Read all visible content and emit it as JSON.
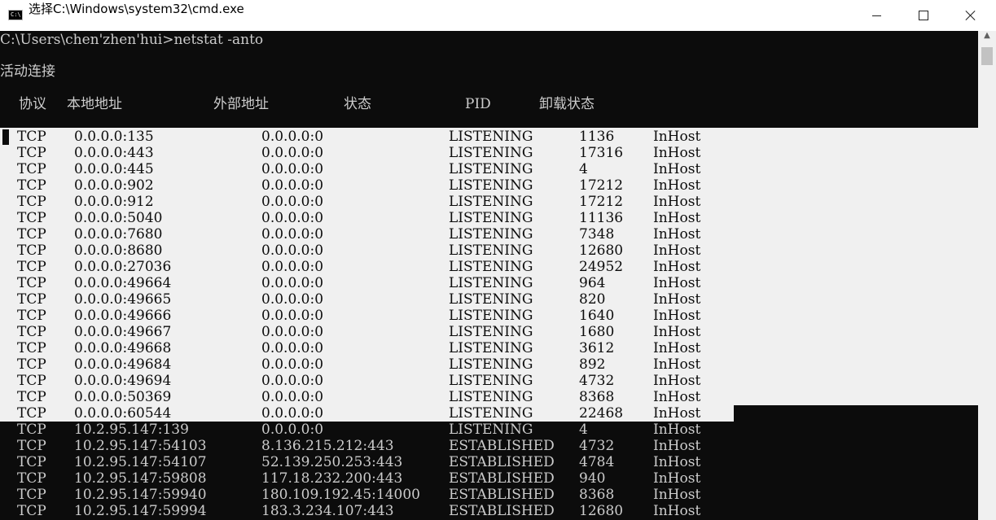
{
  "window": {
    "title": "选择C:\\Windows\\system32\\cmd.exe",
    "icon_text": "C:\\",
    "controls": {
      "minimize": "minimize-icon",
      "maximize": "maximize-icon",
      "close": "close-icon"
    }
  },
  "console": {
    "command_line": "C:\\Users\\chen'zhen'hui>netstat -anto",
    "section_title": "活动连接",
    "headers": {
      "proto": "协议",
      "local": "本地地址",
      "foreign": "外部地址",
      "state": "状态",
      "pid": "PID",
      "offload": "卸载状态"
    },
    "rows": [
      [
        "TCP",
        "0.0.0.0:135",
        "0.0.0.0:0",
        "LISTENING",
        "1136",
        "InHost"
      ],
      [
        "TCP",
        "0.0.0.0:443",
        "0.0.0.0:0",
        "LISTENING",
        "17316",
        "InHost"
      ],
      [
        "TCP",
        "0.0.0.0:445",
        "0.0.0.0:0",
        "LISTENING",
        "4",
        "InHost"
      ],
      [
        "TCP",
        "0.0.0.0:902",
        "0.0.0.0:0",
        "LISTENING",
        "17212",
        "InHost"
      ],
      [
        "TCP",
        "0.0.0.0:912",
        "0.0.0.0:0",
        "LISTENING",
        "17212",
        "InHost"
      ],
      [
        "TCP",
        "0.0.0.0:5040",
        "0.0.0.0:0",
        "LISTENING",
        "11136",
        "InHost"
      ],
      [
        "TCP",
        "0.0.0.0:7680",
        "0.0.0.0:0",
        "LISTENING",
        "7348",
        "InHost"
      ],
      [
        "TCP",
        "0.0.0.0:8680",
        "0.0.0.0:0",
        "LISTENING",
        "12680",
        "InHost"
      ],
      [
        "TCP",
        "0.0.0.0:27036",
        "0.0.0.0:0",
        "LISTENING",
        "24952",
        "InHost"
      ],
      [
        "TCP",
        "0.0.0.0:49664",
        "0.0.0.0:0",
        "LISTENING",
        "964",
        "InHost"
      ],
      [
        "TCP",
        "0.0.0.0:49665",
        "0.0.0.0:0",
        "LISTENING",
        "820",
        "InHost"
      ],
      [
        "TCP",
        "0.0.0.0:49666",
        "0.0.0.0:0",
        "LISTENING",
        "1640",
        "InHost"
      ],
      [
        "TCP",
        "0.0.0.0:49667",
        "0.0.0.0:0",
        "LISTENING",
        "1680",
        "InHost"
      ],
      [
        "TCP",
        "0.0.0.0:49668",
        "0.0.0.0:0",
        "LISTENING",
        "3612",
        "InHost"
      ],
      [
        "TCP",
        "0.0.0.0:49684",
        "0.0.0.0:0",
        "LISTENING",
        "892",
        "InHost"
      ],
      [
        "TCP",
        "0.0.0.0:49694",
        "0.0.0.0:0",
        "LISTENING",
        "4732",
        "InHost"
      ],
      [
        "TCP",
        "0.0.0.0:50369",
        "0.0.0.0:0",
        "LISTENING",
        "8368",
        "InHost"
      ],
      [
        "TCP",
        "0.0.0.0:60544",
        "0.0.0.0:0",
        "LISTENING",
        "22468",
        "InHost"
      ],
      [
        "TCP",
        "10.2.95.147:139",
        "0.0.0.0:0",
        "LISTENING",
        "4",
        "InHost"
      ],
      [
        "TCP",
        "10.2.95.147:54103",
        "8.136.215.212:443",
        "ESTABLISHED",
        "4732",
        "InHost"
      ],
      [
        "TCP",
        "10.2.95.147:54107",
        "52.139.250.253:443",
        "ESTABLISHED",
        "4784",
        "InHost"
      ],
      [
        "TCP",
        "10.2.95.147:59808",
        "117.18.232.200:443",
        "ESTABLISHED",
        "940",
        "InHost"
      ],
      [
        "TCP",
        "10.2.95.147:59940",
        "180.109.192.45:14000",
        "ESTABLISHED",
        "8368",
        "InHost"
      ],
      [
        "TCP",
        "10.2.95.147:59994",
        "183.3.234.107:443",
        "ESTABLISHED",
        "12680",
        "InHost"
      ]
    ],
    "selected_row_count": 18
  },
  "colors": {
    "console_bg": "#0c0c0c",
    "console_fg": "#cccccc",
    "selection_bg": "#f0f0f0",
    "selection_fg": "#0c0c0c"
  },
  "scrollbar": {
    "up_arrow": "scroll-up-arrow-icon"
  }
}
